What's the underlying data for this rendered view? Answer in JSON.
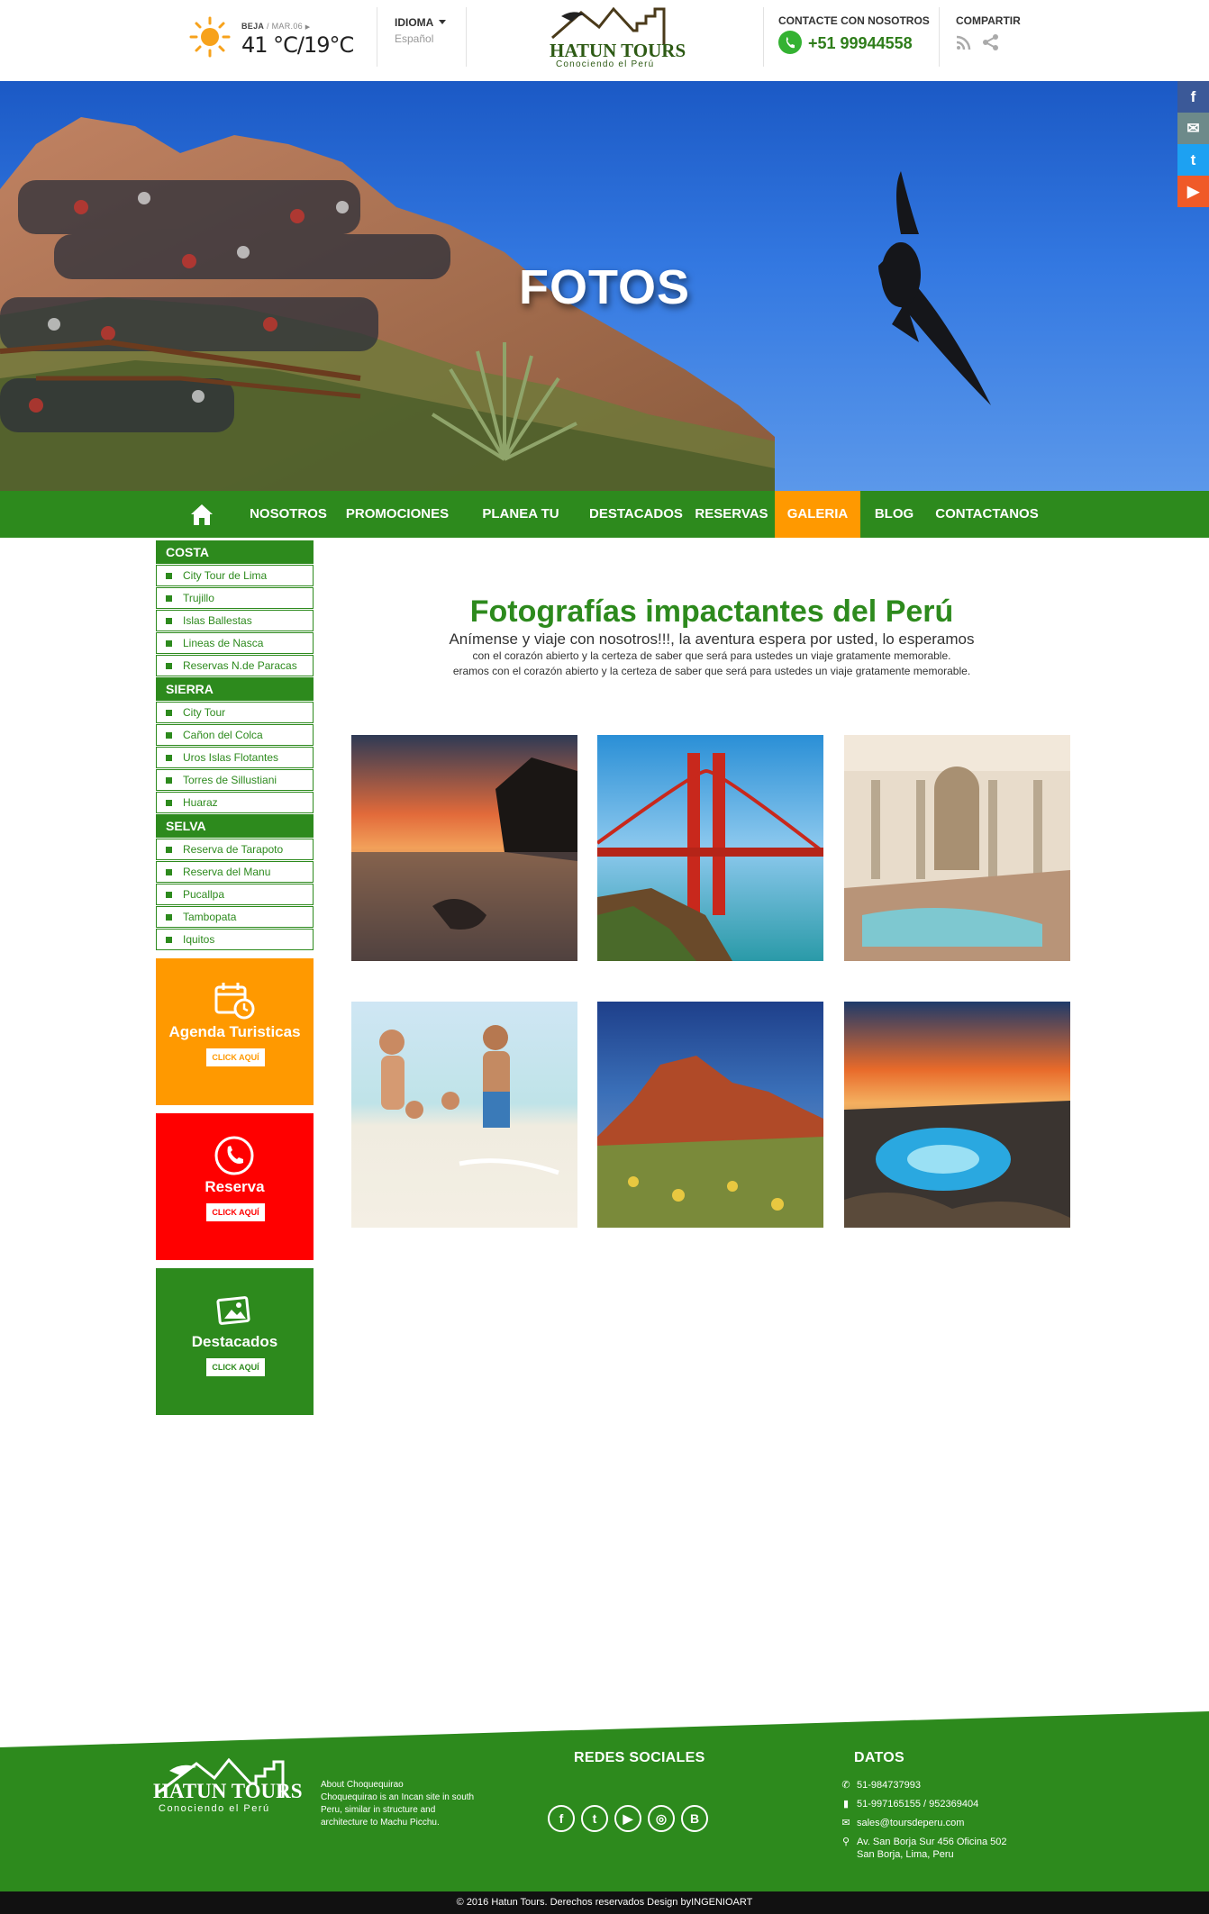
{
  "header": {
    "weather": {
      "place": "BEJA",
      "date": "/ MAR.06",
      "temp": "41 °C/19°C"
    },
    "language": {
      "label": "IDIOMA",
      "value": "Español"
    },
    "logo": {
      "name": "HATUN TOURS",
      "tagline": "Conociendo el Perú"
    },
    "contact": {
      "label": "CONTACTE CON NOSOTROS",
      "phone": "+51 99944558"
    },
    "share": {
      "label": "COMPARTIR"
    }
  },
  "hero": {
    "title": "FOTOS"
  },
  "floating_social": [
    "f",
    "✉",
    "t",
    "▶"
  ],
  "nav": {
    "items": [
      "NOSOTROS",
      "PROMOCIONES",
      "PLANEA TU VIAJE",
      "DESTACADOS",
      "RESERVAS",
      "GALERIA",
      "BLOG",
      "CONTACTANOS"
    ],
    "active": "GALERIA"
  },
  "sidebar": {
    "categories": [
      {
        "name": "COSTA",
        "items": [
          "City Tour de Lima",
          "Trujillo",
          "Islas Ballestas",
          "Lineas de Nasca",
          "Reservas N.de Paracas"
        ]
      },
      {
        "name": "SIERRA",
        "items": [
          "City Tour",
          "Cañon del Colca",
          "Uros Islas Flotantes",
          "Torres de Sillustiani",
          "Huaraz"
        ]
      },
      {
        "name": "SELVA",
        "items": [
          "Reserva de Tarapoto",
          "Reserva del Manu",
          "Pucallpa",
          "Tambopata",
          "Iquitos"
        ]
      }
    ],
    "promos": [
      {
        "title": "Agenda Turisticas",
        "button": "CLICK AQUÍ",
        "color": "#ff9900",
        "icon": "calendar-icon"
      },
      {
        "title": "Reserva",
        "button": "CLICK AQUÍ",
        "color": "#ff0000",
        "icon": "phone-icon"
      },
      {
        "title": "Destacados",
        "button": "CLICK AQUÍ",
        "color": "#2d8a1d",
        "icon": "image-icon"
      }
    ]
  },
  "main": {
    "title": "Fotografías impactantes del Perú",
    "subtitle": "Anímense y viaje con nosotros!!!, la aventura espera por usted, lo esperamos",
    "line1": "con el corazón abierto y la certeza de saber que será para ustedes un viaje gratamente memorable.",
    "line2": "eramos con el corazón abierto y la certeza de saber que será para ustedes un viaje gratamente memorable."
  },
  "footer": {
    "about_title": "About Choquequirao",
    "about_text": "Choquequirao is an Incan site in south Peru, similar in structure and architecture to Machu Picchu.",
    "social_heading": "REDES SOCIALES",
    "data_heading": "DATOS",
    "phone1": "51-984737993",
    "phone2": "51-997165155 / 952369404",
    "email": "sales@toursdeperu.com",
    "address1": "Av. San Borja Sur 456 Oficina 502",
    "address2": "San Borja, Lima, Peru",
    "copyright": "© 2016  Hatun Tours. Derechos reservados Design byINGENIOART"
  },
  "colors": {
    "green": "#2d8a1d",
    "orange": "#ff9900",
    "red": "#ff0000"
  }
}
